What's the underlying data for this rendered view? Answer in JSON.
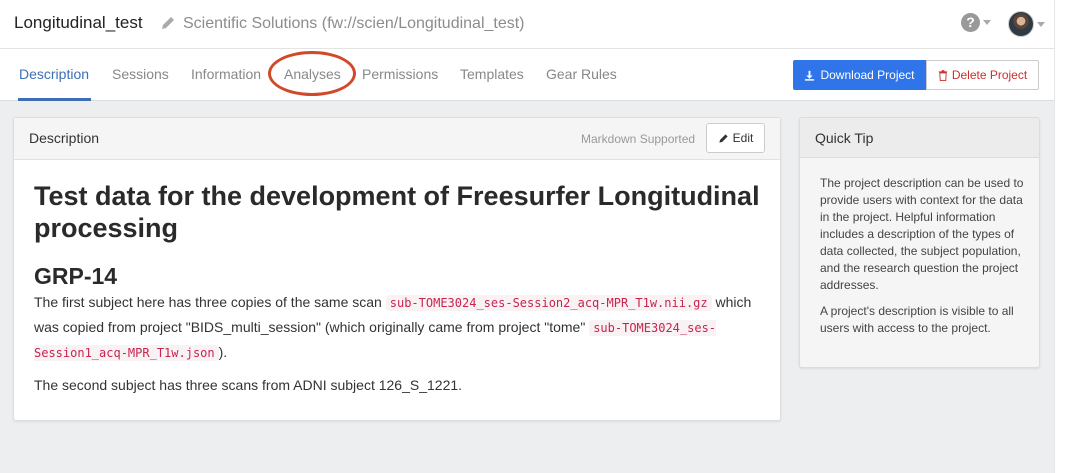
{
  "header": {
    "project_name": "Longitudinal_test",
    "subtitle": "Scientific Solutions (fw://scien/Longitudinal_test)",
    "icons": {
      "edit": "pencil-icon",
      "help": "question-circle-icon",
      "user": "avatar"
    }
  },
  "tabs": [
    {
      "label": "Description",
      "active": true
    },
    {
      "label": "Sessions"
    },
    {
      "label": "Information"
    },
    {
      "label": "Analyses",
      "highlighted": true
    },
    {
      "label": "Permissions"
    },
    {
      "label": "Templates"
    },
    {
      "label": "Gear Rules"
    }
  ],
  "actions": {
    "download_label": "Download Project",
    "delete_label": "Delete Project"
  },
  "description_panel": {
    "title": "Description",
    "markdown_note": "Markdown Supported",
    "edit_label": "Edit",
    "content": {
      "h1": "Test data for the development of Freesurfer Longitudinal processing",
      "h2": "GRP-14",
      "p1_a": "The first subject here has three copies of the same scan ",
      "p1_code1": "sub-TOME3024_ses-Session2_acq-MPR_T1w.nii.gz",
      "p1_b": " which was copied from project \"BIDS_multi_session\" (which originally came from project \"tome\" ",
      "p1_code2": "sub-TOME3024_ses-Session1_acq-MPR_T1w.json",
      "p1_c": ").",
      "p2": "The second subject has three scans from ADNI subject 126_S_1221."
    }
  },
  "quick_tip": {
    "title": "Quick Tip",
    "p1": "The project description can be used to provide users with context for the data in the project. Helpful information includes a description of the types of data collected, the subject population, and the research question the project addresses.",
    "p2": "A project's description is visible to all users with access to the project."
  },
  "colors": {
    "accent": "#3d6fb6",
    "primary_button": "#2f74e8",
    "danger": "#c9302c",
    "highlight_oval": "#d2492a"
  }
}
